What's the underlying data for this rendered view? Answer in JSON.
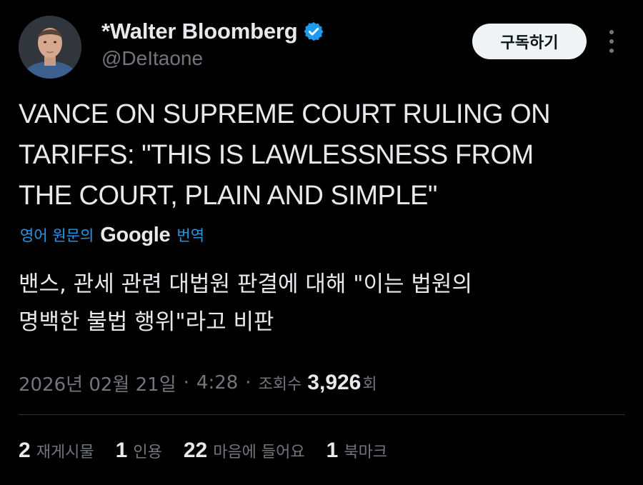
{
  "author": {
    "display_name": "*Walter Bloomberg",
    "handle": "@DeItaone",
    "verified_icon": "verified-badge-icon",
    "avatar": "profile-photo"
  },
  "header": {
    "subscribe_label": "구독하기",
    "more_icon": "more-options-icon"
  },
  "tweet": {
    "text": "VANCE ON SUPREME COURT RULING ON\nTARIFFS: \"THIS IS LAWLESSNESS FROM\nTHE COURT, PLAIN AND SIMPLE\"",
    "translation_prefix": "영어 원문의",
    "translation_brand": "Google",
    "translation_suffix": "번역",
    "translated_text": "밴스, 관세 관련 대법원 판결에 대해 \"이는 법원의\n명백한 불법 행위\"라고 비판"
  },
  "meta": {
    "date": "2026년 02월 21일",
    "separator": "·",
    "time": "4:28",
    "views_label": "조회수",
    "views_count": "3,926",
    "views_unit": "회"
  },
  "stats": [
    {
      "count": "2",
      "label": "재게시물"
    },
    {
      "count": "1",
      "label": "인용"
    },
    {
      "count": "22",
      "label": "마음에 들어요"
    },
    {
      "count": "1",
      "label": "북마크"
    }
  ],
  "colors": {
    "background": "#000000",
    "text_primary": "#e7e9ea",
    "text_secondary": "#71767b",
    "link_blue": "#1d9bf0",
    "verified_blue": "#1d9bf0",
    "button_bg": "#eff3f4"
  }
}
